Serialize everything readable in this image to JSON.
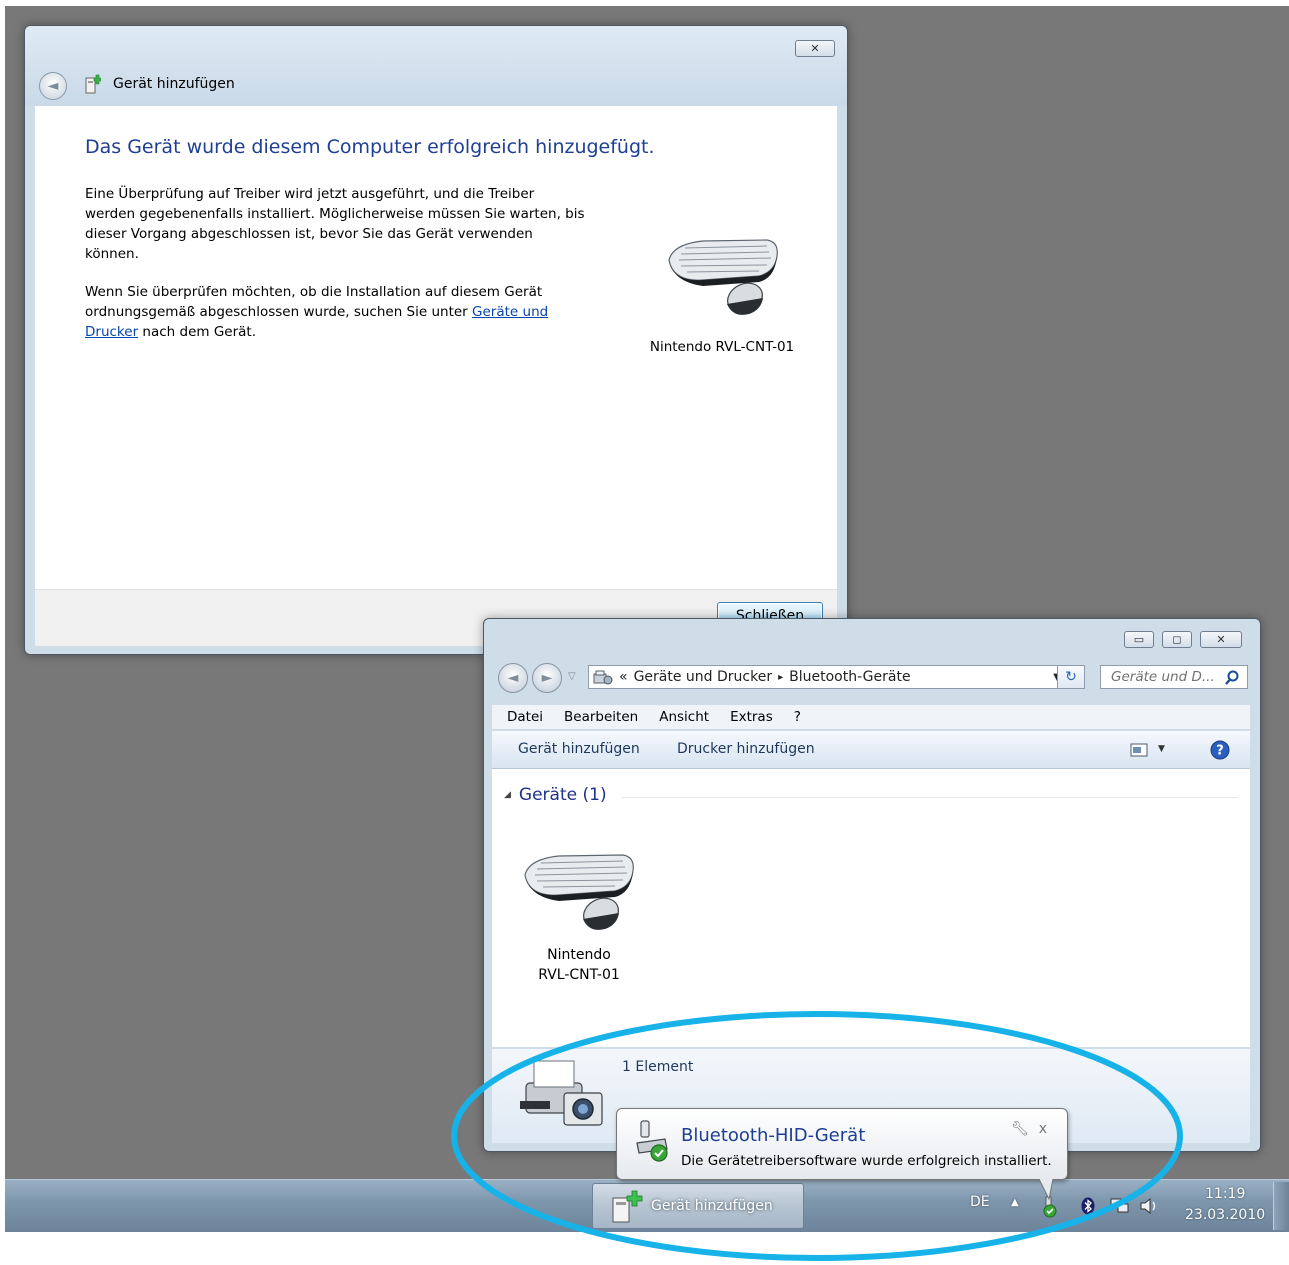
{
  "wizard": {
    "title": "Gerät hinzufügen",
    "heading": "Das Gerät wurde diesem Computer erfolgreich hinzugefügt.",
    "para1": "Eine Überprüfung auf Treiber wird jetzt ausgeführt, und die Treiber werden gegebenenfalls installiert. Möglicherweise müssen Sie warten, bis dieser Vorgang abgeschlossen ist, bevor Sie das Gerät verwenden können.",
    "para2_before": "Wenn Sie überprüfen möchten, ob die Installation auf diesem Gerät ordnungsgemäß abgeschlossen wurde, suchen Sie unter ",
    "para2_link": "Geräte und Drucker",
    "para2_after": " nach dem Gerät.",
    "device_name": "Nintendo RVL-CNT-01",
    "close_button": "Schließen",
    "window_close_glyph": "✕"
  },
  "explorer": {
    "breadcrumb": {
      "overflow": "«",
      "segment1": "Geräte und Drucker",
      "separator": "▸",
      "segment2": "Bluetooth-Geräte"
    },
    "search_placeholder": "Geräte und D...",
    "menu": [
      "Datei",
      "Bearbeiten",
      "Ansicht",
      "Extras",
      "?"
    ],
    "commands": {
      "add_device": "Gerät hinzufügen",
      "add_printer": "Drucker hinzufügen"
    },
    "group_label": "Geräte (1)",
    "device_tile": {
      "line1": "Nintendo",
      "line2": "RVL-CNT-01"
    },
    "details_text": "1 Element"
  },
  "balloon": {
    "title": "Bluetooth-HID-Gerät",
    "message": "Die Gerätetreibersoftware wurde erfolgreich installiert."
  },
  "taskbar": {
    "task_label": "Gerät hinzufügen",
    "language": "DE",
    "time": "11:19",
    "date": "23.03.2010"
  },
  "colors": {
    "highlight": "#17b3e8",
    "heading_blue": "#1f3f95",
    "desktop": "#787878"
  },
  "icons": [
    "back-arrow-icon",
    "add-device-icon",
    "keyboard-mouse-icon",
    "search-icon",
    "refresh-icon",
    "help-icon",
    "view-options-icon",
    "bluetooth-icon",
    "volume-icon",
    "network-icon",
    "show-hidden-icons-icon",
    "printer-camera-icon"
  ]
}
